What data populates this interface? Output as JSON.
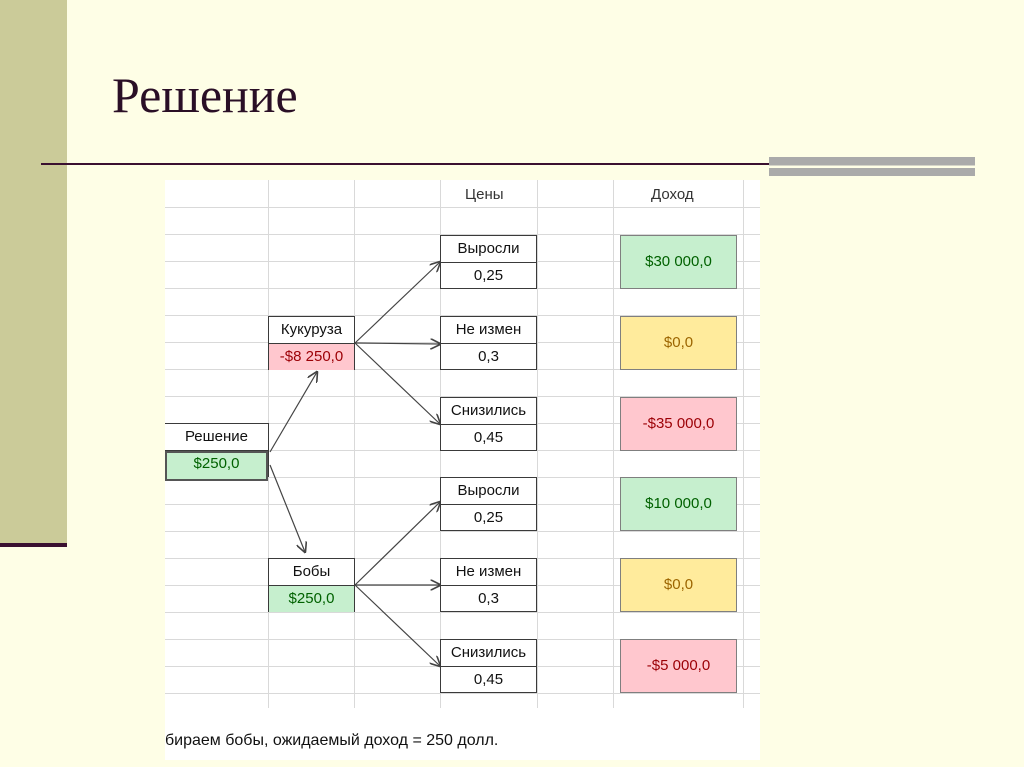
{
  "slide": {
    "title": "Решение"
  },
  "tree": {
    "headers": {
      "prices": "Цены",
      "income": "Доход"
    },
    "root": {
      "label": "Решение",
      "value": "$250,0"
    },
    "branches": [
      {
        "label": "Кукуруза",
        "value": "-$8 250,0",
        "outcomes": [
          {
            "label": "Выросли",
            "prob": "0,25",
            "payoff": "$30 000,0"
          },
          {
            "label": "Не измен",
            "prob": "0,3",
            "payoff": "$0,0"
          },
          {
            "label": "Снизились",
            "prob": "0,45",
            "payoff": "-$35 000,0"
          }
        ]
      },
      {
        "label": "Бобы",
        "value": "$250,0",
        "outcomes": [
          {
            "label": "Выросли",
            "prob": "0,25",
            "payoff": "$10 000,0"
          },
          {
            "label": "Не измен",
            "prob": "0,3",
            "payoff": "$0,0"
          },
          {
            "label": "Снизились",
            "prob": "0,45",
            "payoff": "-$5 000,0"
          }
        ]
      }
    ],
    "conclusion": "бираем бобы, ожидаемый доход = 250 долл."
  },
  "colors": {
    "positive": "#c6efce",
    "neutral": "#ffeb9c",
    "negative": "#ffc7ce"
  }
}
